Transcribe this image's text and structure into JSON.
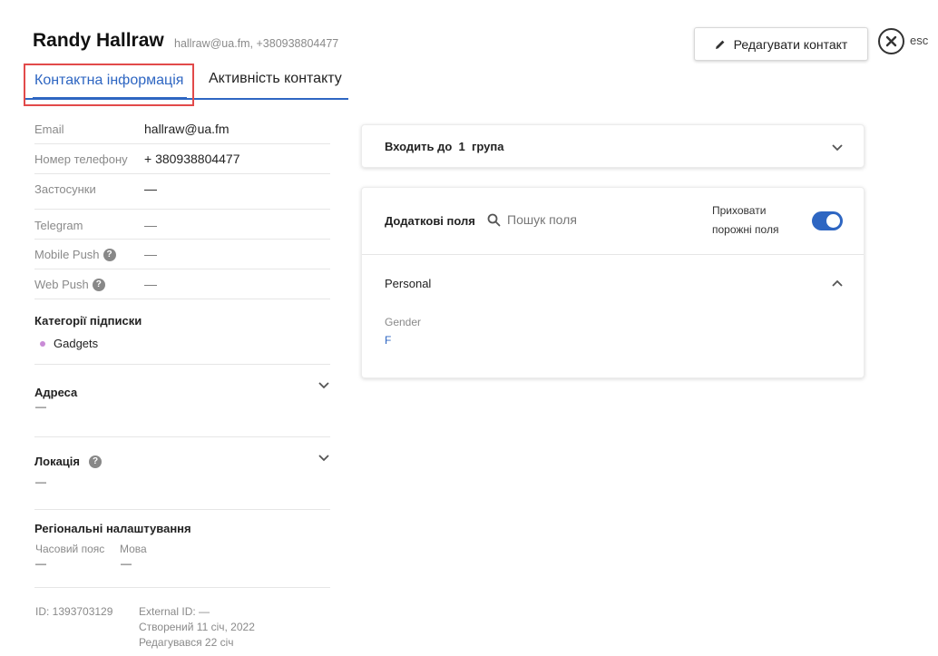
{
  "header": {
    "name": "Randy Hallraw",
    "subtitle": "hallraw@ua.fm, +380938804477",
    "edit_button": "Редагувати контакт",
    "esc_label": "esc"
  },
  "tabs": [
    {
      "label": "Контактна інформація"
    },
    {
      "label": "Активність контакту"
    }
  ],
  "contact_info": {
    "rows": [
      {
        "label": "Email",
        "value": "hallraw@ua.fm"
      },
      {
        "label": "Номер телефону",
        "value": "+ 380938804477"
      },
      {
        "label": "Застосунки",
        "value": "—"
      },
      {
        "label": "Telegram",
        "value": "—"
      },
      {
        "label": "Mobile Push",
        "value": "—"
      },
      {
        "label": "Web Push",
        "value": "—"
      }
    ],
    "help_icon": "?",
    "subscription": {
      "title": "Категорії підписки",
      "items": [
        "Gadgets"
      ]
    },
    "address": {
      "title": "Адреса",
      "value": "—"
    },
    "location": {
      "title": "Локація",
      "value": "—"
    },
    "regional": {
      "title": "Регіональні налаштування",
      "timezone_label": "Часовий пояс",
      "timezone_value": "—",
      "language_label": "Мова",
      "language_value": "—"
    },
    "meta": {
      "id": "ID: 1393703129",
      "external_id": "External ID: —",
      "created": "Створений 11 січ, 2022",
      "edited": "Редагувався 22 січ"
    }
  },
  "groups_card": {
    "title": "Входить до  1  група"
  },
  "fields_card": {
    "title": "Додаткові поля",
    "search_placeholder": "Пошук поля",
    "hide_empty_label": "Приховати порожні поля",
    "hide_empty_on": true,
    "section": "Personal",
    "field_label": "Gender",
    "field_value": "F"
  },
  "colors": {
    "accent": "#2e66c2",
    "highlight": "#e24a4a",
    "bullet": "#c98bd6"
  }
}
